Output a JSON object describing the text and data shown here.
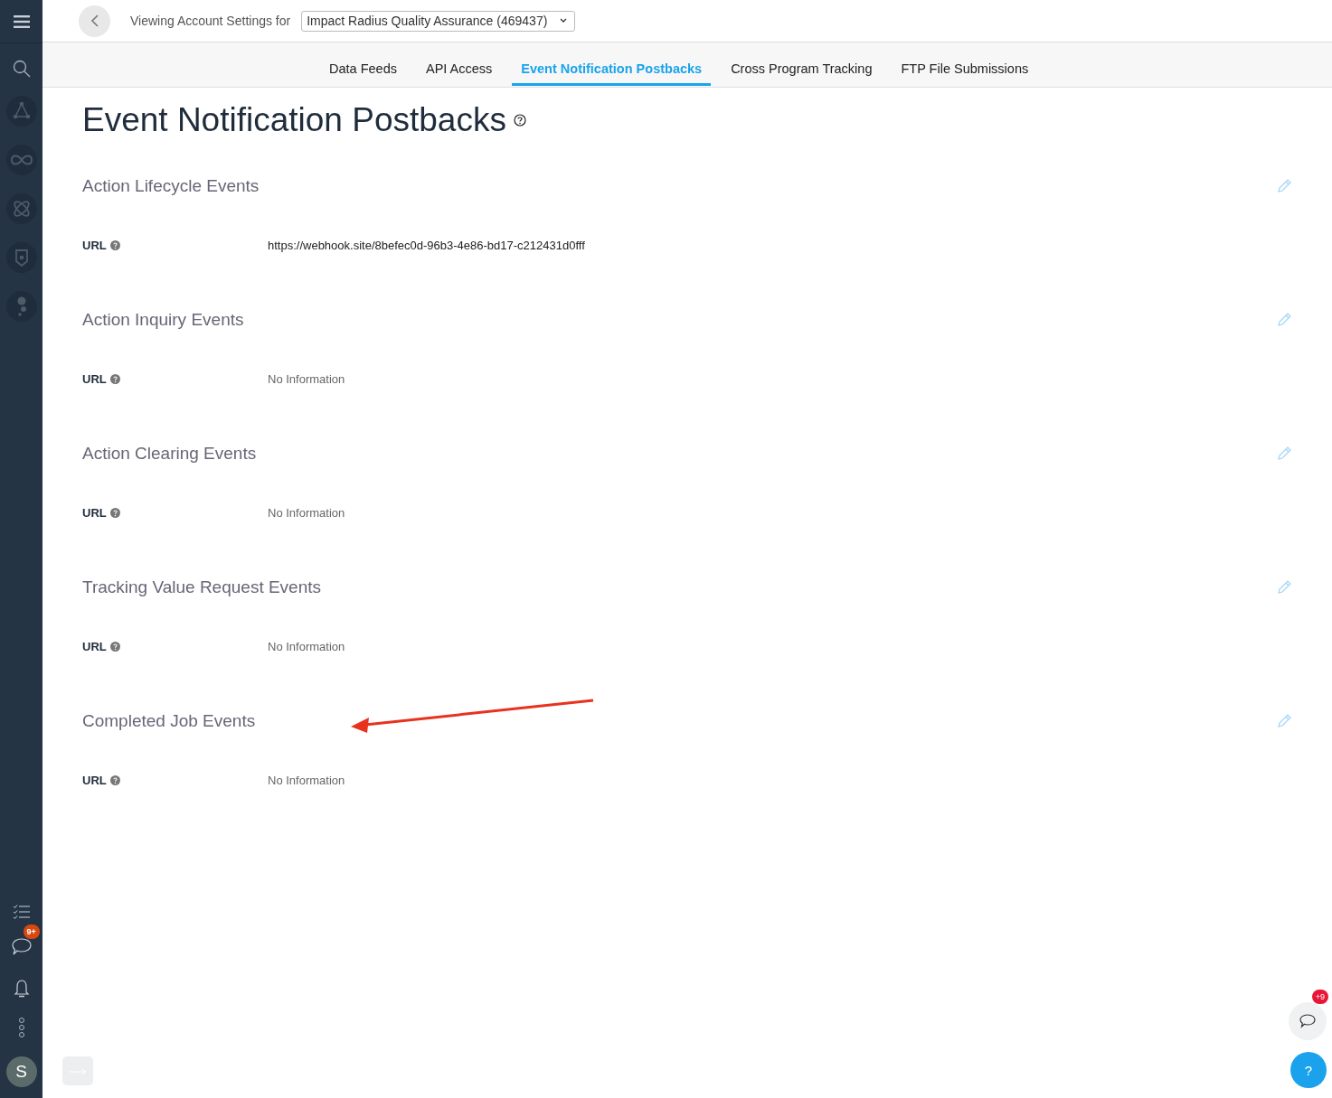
{
  "header": {
    "label": "Viewing Account Settings for",
    "account": "Impact Radius Quality Assurance (469437)"
  },
  "tabs": [
    {
      "label": "Data Feeds",
      "selected": false
    },
    {
      "label": "API Access",
      "selected": false
    },
    {
      "label": "Event Notification Postbacks",
      "selected": true
    },
    {
      "label": "Cross Program Tracking",
      "selected": false
    },
    {
      "label": "FTP File Submissions",
      "selected": false
    }
  ],
  "page_title": "Event Notification Postbacks",
  "sections": [
    {
      "title": "Action Lifecycle Events",
      "field": "URL",
      "value": "https://webhook.site/8befec0d-96b3-4e86-bd17-c212431d0fff",
      "empty": false
    },
    {
      "title": "Action Inquiry Events",
      "field": "URL",
      "value": "No Information",
      "empty": true
    },
    {
      "title": "Action Clearing Events",
      "field": "URL",
      "value": "No Information",
      "empty": true
    },
    {
      "title": "Tracking Value Request Events",
      "field": "URL",
      "value": "No Information",
      "empty": true
    },
    {
      "title": "Completed Job Events",
      "field": "URL",
      "value": "No Information",
      "empty": true
    }
  ],
  "sidebar": {
    "chat_badge": "9+",
    "avatar": "S"
  },
  "chat_widget": {
    "badge": "+9",
    "help": "?"
  }
}
